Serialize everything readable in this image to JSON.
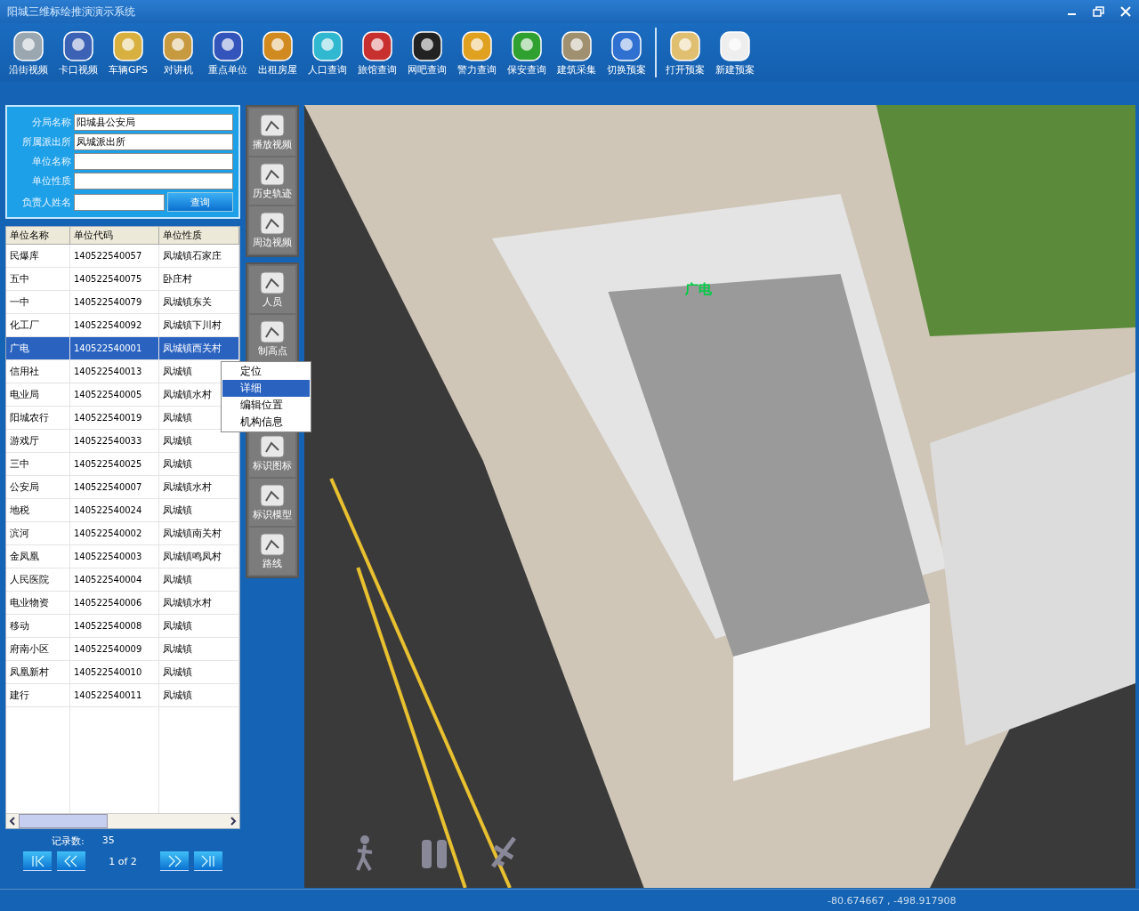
{
  "window": {
    "title": "阳城三维标绘推演演示系统"
  },
  "toolbar": {
    "groups": [
      [
        {
          "label": "沿街视频"
        },
        {
          "label": "卡口视频"
        },
        {
          "label": "车辆GPS"
        },
        {
          "label": "对讲机"
        },
        {
          "label": "重点单位"
        },
        {
          "label": "出租房屋"
        },
        {
          "label": "人口查询"
        },
        {
          "label": "旅馆查询"
        },
        {
          "label": "网吧查询"
        },
        {
          "label": "警力查询"
        },
        {
          "label": "保安查询"
        },
        {
          "label": "建筑采集"
        },
        {
          "label": "切换预案"
        }
      ],
      [
        {
          "label": "打开预案"
        },
        {
          "label": "新建预案"
        }
      ]
    ]
  },
  "search": {
    "fields": [
      {
        "label": "分局名称",
        "value": "阳城县公安局"
      },
      {
        "label": "所属派出所",
        "value": "凤城派出所"
      },
      {
        "label": "单位名称"
      },
      {
        "label": "单位性质"
      },
      {
        "label": "负责人姓名"
      }
    ],
    "button": "查询"
  },
  "table": {
    "columns": [
      "单位名称",
      "单位代码",
      "单位性质"
    ],
    "rows": [
      {
        "cells": [
          "民爆库",
          "140522540057",
          "凤城镇石家庄"
        ],
        "selected": false
      },
      {
        "cells": [
          "五中",
          "140522540075",
          "卧庄村"
        ],
        "selected": false
      },
      {
        "cells": [
          "一中",
          "140522540079",
          "凤城镇东关"
        ],
        "selected": false
      },
      {
        "cells": [
          "化工厂",
          "140522540092",
          "凤城镇下川村"
        ],
        "selected": false
      },
      {
        "cells": [
          "广电",
          "140522540001",
          "凤城镇西关村"
        ],
        "selected": true
      },
      {
        "cells": [
          "信用社",
          "140522540013",
          "凤城镇"
        ],
        "selected": false
      },
      {
        "cells": [
          "电业局",
          "140522540005",
          "凤城镇水村"
        ],
        "selected": false
      },
      {
        "cells": [
          "阳城农行",
          "140522540019",
          "凤城镇"
        ],
        "selected": false
      },
      {
        "cells": [
          "游戏厅",
          "140522540033",
          "凤城镇"
        ],
        "selected": false
      },
      {
        "cells": [
          "三中",
          "140522540025",
          "凤城镇"
        ],
        "selected": false
      },
      {
        "cells": [
          "公安局",
          "140522540007",
          "凤城镇水村"
        ],
        "selected": false
      },
      {
        "cells": [
          "地税",
          "140522540024",
          "凤城镇"
        ],
        "selected": false
      },
      {
        "cells": [
          "滨河",
          "140522540002",
          "凤城镇南关村"
        ],
        "selected": false
      },
      {
        "cells": [
          "金凤凰",
          "140522540003",
          "凤城镇鸣凤村"
        ],
        "selected": false
      },
      {
        "cells": [
          "人民医院",
          "140522540004",
          "凤城镇"
        ],
        "selected": false
      },
      {
        "cells": [
          "电业物资",
          "140522540006",
          "凤城镇水村"
        ],
        "selected": false
      },
      {
        "cells": [
          "移动",
          "140522540008",
          "凤城镇"
        ],
        "selected": false
      },
      {
        "cells": [
          "府南小区",
          "140522540009",
          "凤城镇"
        ],
        "selected": false
      },
      {
        "cells": [
          "凤凰新村",
          "140522540010",
          "凤城镇"
        ],
        "selected": false
      },
      {
        "cells": [
          "建行",
          "140522540011",
          "凤城镇"
        ],
        "selected": false
      }
    ]
  },
  "context_menu": {
    "items": [
      {
        "label": "定位",
        "selected": false
      },
      {
        "label": "详细",
        "selected": true
      },
      {
        "label": "编辑位置",
        "selected": false
      },
      {
        "label": "机构信息",
        "selected": false
      }
    ]
  },
  "pager": {
    "count_label": "记录数:",
    "count": "35",
    "page": "1 of 2"
  },
  "side_tools": {
    "groups": [
      [
        {
          "label": "播放视频"
        },
        {
          "label": "历史轨迹"
        },
        {
          "label": "周边视频"
        }
      ],
      [
        {
          "label": "人员"
        },
        {
          "label": "制高点"
        },
        {
          "label": "标识图标"
        },
        {
          "label": "标识模型"
        },
        {
          "label": "路线"
        }
      ]
    ]
  },
  "map": {
    "label": "广电"
  },
  "status_bar": {
    "coordinates": "-80.674667 , -498.917908"
  }
}
